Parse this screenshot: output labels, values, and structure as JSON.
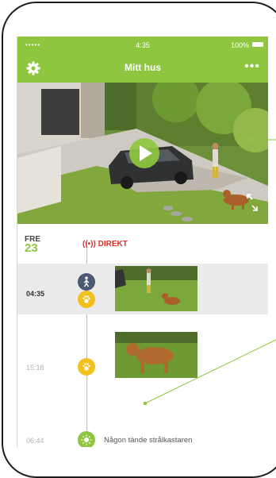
{
  "status_bar": {
    "signal": "•••••",
    "time": "4:35",
    "battery": "100%"
  },
  "nav": {
    "title": "Mitt hus",
    "settings_icon": "gear-icon",
    "more_label": "•••"
  },
  "video": {
    "play_icon": "play-icon",
    "expand_icon": "expand-icon"
  },
  "timeline": {
    "day_name": "FRE",
    "day_number": "23",
    "live_label": "DIREKT",
    "events": [
      {
        "time": "04:35",
        "icons": [
          "person-icon",
          "paw-icon"
        ]
      },
      {
        "time": "15:18",
        "icons": [
          "paw-icon"
        ]
      },
      {
        "time": "06:44",
        "icons": [
          "light-icon"
        ],
        "text": "Någon tände strålkastaren"
      }
    ]
  },
  "colors": {
    "accent": "#8ec640",
    "live": "#d9322b",
    "marker_person": "#4a5a73",
    "marker_animal": "#f2c11d"
  }
}
